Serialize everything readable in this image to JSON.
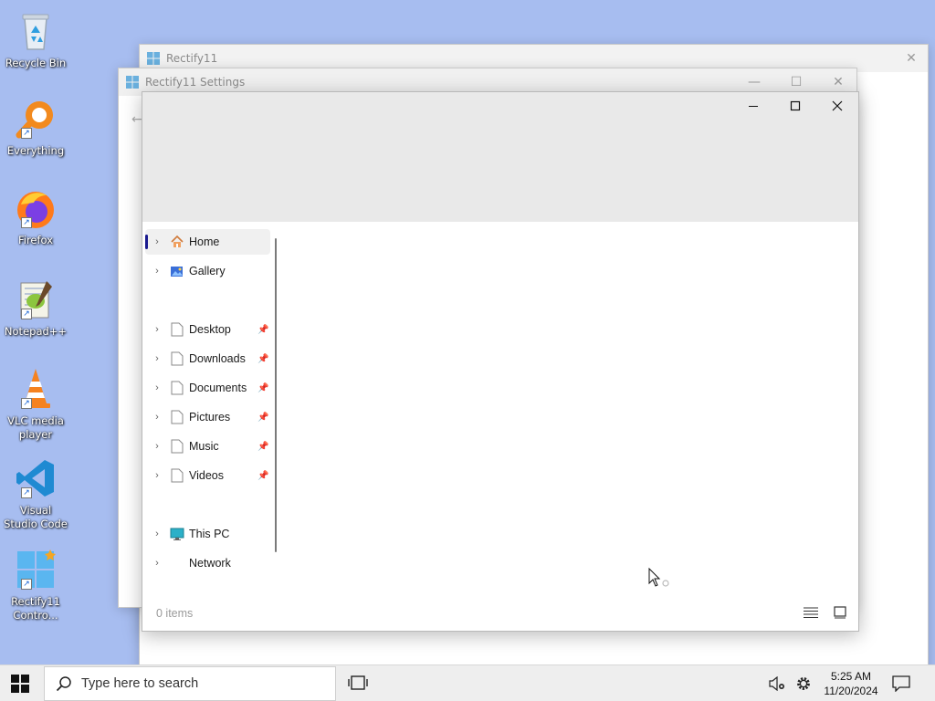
{
  "desktop": {
    "icons": [
      {
        "name": "recycle-bin",
        "label": "Recycle Bin"
      },
      {
        "name": "everything",
        "label": "Everything"
      },
      {
        "name": "firefox",
        "label": "Firefox"
      },
      {
        "name": "notepadpp",
        "label": "Notepad++"
      },
      {
        "name": "vlc",
        "label": "VLC media player"
      },
      {
        "name": "vscode",
        "label": "Visual Studio Code"
      },
      {
        "name": "rectify11-control",
        "label": "Rectify11 Contro..."
      }
    ]
  },
  "windows": {
    "back_window": {
      "title": "Rectify11",
      "close": "✕"
    },
    "settings_window": {
      "title": "Rectify11 Settings",
      "minimize": "—",
      "maximize": "☐",
      "close": "✕",
      "back": "←"
    }
  },
  "explorer": {
    "nav": [
      {
        "label": "Home",
        "icon": "home-icon",
        "selected": true
      },
      {
        "label": "Gallery",
        "icon": "gallery-icon"
      },
      {
        "label": "Desktop",
        "icon": "file-icon",
        "pinned": true
      },
      {
        "label": "Downloads",
        "icon": "file-icon",
        "pinned": true
      },
      {
        "label": "Documents",
        "icon": "file-icon",
        "pinned": true
      },
      {
        "label": "Pictures",
        "icon": "file-icon",
        "pinned": true
      },
      {
        "label": "Music",
        "icon": "file-icon",
        "pinned": true
      },
      {
        "label": "Videos",
        "icon": "file-icon",
        "pinned": true
      },
      {
        "label": "This PC",
        "icon": "monitor-icon"
      },
      {
        "label": "Network",
        "icon": ""
      }
    ],
    "status": "0 items"
  },
  "taskbar": {
    "search_placeholder": "Type here to search",
    "time": "5:25 AM",
    "date": "11/20/2024"
  },
  "colors": {
    "desktop_bg": "#a7bdf0",
    "accent": "#1b1b8f"
  }
}
